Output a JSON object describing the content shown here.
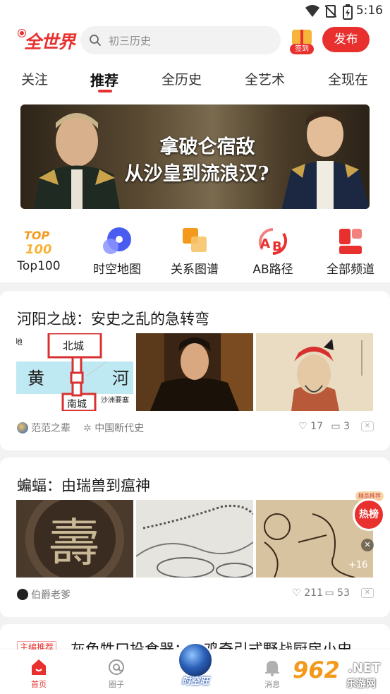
{
  "status_bar": {
    "time": "5:16"
  },
  "header": {
    "logo": "全世界",
    "search_placeholder": "初三历史",
    "gift_label": "签到",
    "publish_label": "发布"
  },
  "tabs": [
    {
      "label": "关注",
      "active": false
    },
    {
      "label": "推荐",
      "active": true
    },
    {
      "label": "全历史",
      "active": false
    },
    {
      "label": "全艺术",
      "active": false
    },
    {
      "label": "全现在",
      "active": false
    }
  ],
  "banner": {
    "line1": "拿破仑宿敌",
    "line2": "从沙皇到流浪汉?",
    "page_count": 2,
    "active_page": 2
  },
  "quick_nav": [
    {
      "label": "Top100",
      "icon": "top100-icon"
    },
    {
      "label": "时空地图",
      "icon": "spacetime-map-icon"
    },
    {
      "label": "关系图谱",
      "icon": "relation-graph-icon"
    },
    {
      "label": "AB路径",
      "icon": "ab-path-icon"
    },
    {
      "label": "全部频道",
      "icon": "all-channels-icon"
    }
  ],
  "feed": [
    {
      "title": "河阳之战：安史之乱的急转弯",
      "image1_labels": {
        "corner": "地",
        "north": "北城",
        "yellow": "黄",
        "river": "河",
        "south": "南城",
        "island": "沙洲要塞"
      },
      "author": "范范之辈",
      "channel": "中国断代史",
      "likes": "17",
      "comments": "3"
    },
    {
      "title": "蝙蝠：由瑞兽到瘟神",
      "image1_char": "壽",
      "hot_badge_top": "精品推荐",
      "hot_badge": "热榜",
      "more_images": "+16",
      "author": "伯爵老爹",
      "likes": "211",
      "comments": "53"
    }
  ],
  "partial_card": {
    "tag": "主编推荐",
    "title": "灰色牲口投食器：…鸡奇引式野战厨房小史"
  },
  "bottom_nav": [
    {
      "label": "首页",
      "icon": "home-icon",
      "active": true
    },
    {
      "label": "圈子",
      "icon": "circle-icon",
      "active": false
    },
    {
      "label": "时空旺",
      "icon": "globe-icon",
      "active": false
    },
    {
      "label": "消息",
      "icon": "bell-icon",
      "active": false
    }
  ],
  "watermark": {
    "number": "962",
    "domain": ".NET",
    "site": "乐游网"
  },
  "colors": {
    "brand": "#e8312f",
    "background": "#f2f2f2"
  }
}
